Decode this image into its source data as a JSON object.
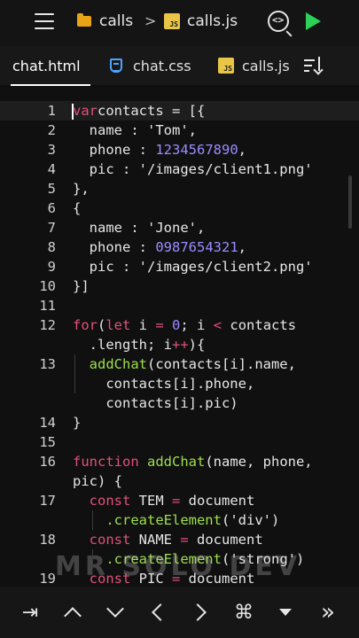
{
  "topbar": {
    "folder": "calls",
    "file": "calls.js",
    "menu_icon": "hamburger-menu-icon",
    "search_icon": "search-code-icon",
    "run_icon": "run-play-icon",
    "run_color": "#2bd158"
  },
  "tabs": [
    {
      "label": "chat.html",
      "icon": ""
    },
    {
      "label": "chat.css",
      "icon": "css-file-icon"
    },
    {
      "label": "calls.js",
      "icon": "js-file-icon"
    }
  ],
  "js_badge": "JS",
  "editor": {
    "lines": [
      {
        "n": "1",
        "tokens": [
          [
            "kw",
            "var"
          ],
          [
            "",
            "contacts = [{"
          ]
        ]
      },
      {
        "n": "2",
        "tokens": [
          [
            "",
            "  name : "
          ],
          [
            "str",
            "'Tom'"
          ],
          [
            "",
            ","
          ]
        ]
      },
      {
        "n": "3",
        "tokens": [
          [
            "",
            "  phone : "
          ],
          [
            "num",
            "1234567890"
          ],
          [
            "",
            ","
          ]
        ]
      },
      {
        "n": "4",
        "tokens": [
          [
            "",
            "  pic : "
          ],
          [
            "str",
            "'/images/client1.png'"
          ]
        ]
      },
      {
        "n": "5",
        "tokens": [
          [
            "",
            "},"
          ]
        ]
      },
      {
        "n": "6",
        "tokens": [
          [
            "",
            "{"
          ]
        ]
      },
      {
        "n": "7",
        "tokens": [
          [
            "",
            "  name : "
          ],
          [
            "str",
            "'Jone'"
          ],
          [
            "",
            ","
          ]
        ]
      },
      {
        "n": "8",
        "tokens": [
          [
            "",
            "  phone : "
          ],
          [
            "num",
            "0987654321"
          ],
          [
            "",
            ","
          ]
        ]
      },
      {
        "n": "9",
        "tokens": [
          [
            "",
            "  pic : "
          ],
          [
            "str",
            "'/images/client2.png'"
          ]
        ]
      },
      {
        "n": "10",
        "tokens": [
          [
            "",
            "}]"
          ]
        ]
      },
      {
        "n": "11",
        "tokens": []
      },
      {
        "n": "12",
        "tokens": [
          [
            "kw",
            "for"
          ],
          [
            "",
            "("
          ],
          [
            "kw",
            "let"
          ],
          [
            "",
            " i "
          ],
          [
            "op",
            "="
          ],
          [
            "",
            " "
          ],
          [
            "num",
            "0"
          ],
          [
            "",
            "; i "
          ],
          [
            "op",
            "<"
          ],
          [
            "",
            " contacts"
          ]
        ]
      },
      {
        "n": "",
        "tokens": [
          [
            "",
            "  .length; i"
          ],
          [
            "op",
            "++"
          ],
          [
            "",
            ")"
          ],
          [
            "",
            "{"
          ]
        ]
      },
      {
        "n": "13",
        "tokens": [
          [
            "fn",
            "  addChat"
          ],
          [
            "",
            "(contacts[i].name,"
          ]
        ]
      },
      {
        "n": "",
        "tokens": [
          [
            "",
            "    contacts[i].phone,"
          ]
        ]
      },
      {
        "n": "",
        "tokens": [
          [
            "",
            "    contacts[i].pic)"
          ]
        ]
      },
      {
        "n": "14",
        "tokens": [
          [
            "",
            "}"
          ]
        ]
      },
      {
        "n": "15",
        "tokens": []
      },
      {
        "n": "16",
        "tokens": [
          [
            "kw",
            "function"
          ],
          [
            "",
            " "
          ],
          [
            "fn",
            "addChat"
          ],
          [
            "",
            "(name, phone,"
          ]
        ]
      },
      {
        "n": "",
        "tokens": [
          [
            "",
            "pic) {"
          ]
        ]
      },
      {
        "n": "17",
        "tokens": [
          [
            "kw",
            "  const"
          ],
          [
            "",
            " TEM "
          ],
          [
            "op",
            "="
          ],
          [
            "",
            " document"
          ]
        ]
      },
      {
        "n": "",
        "tokens": [
          [
            "fn",
            "    .createElement"
          ],
          [
            "",
            "("
          ],
          [
            "str",
            "'div'"
          ],
          [
            "",
            ")"
          ]
        ]
      },
      {
        "n": "18",
        "tokens": [
          [
            "kw",
            "  const"
          ],
          [
            "",
            " NAME "
          ],
          [
            "op",
            "="
          ],
          [
            "",
            " document"
          ]
        ]
      },
      {
        "n": "",
        "tokens": [
          [
            "fn",
            "    .createElement"
          ],
          [
            "",
            "("
          ],
          [
            "str",
            "'strong'"
          ],
          [
            "",
            ")"
          ]
        ]
      },
      {
        "n": "19",
        "tokens": [
          [
            "kw",
            "  const"
          ],
          [
            "",
            " PIC "
          ],
          [
            "op",
            "="
          ],
          [
            "",
            " document"
          ]
        ]
      }
    ]
  },
  "watermark": "MR SOLO DEV",
  "keybar": {
    "tab_key": "⇥",
    "cmd_key": "⌘",
    "more_key": "»"
  }
}
